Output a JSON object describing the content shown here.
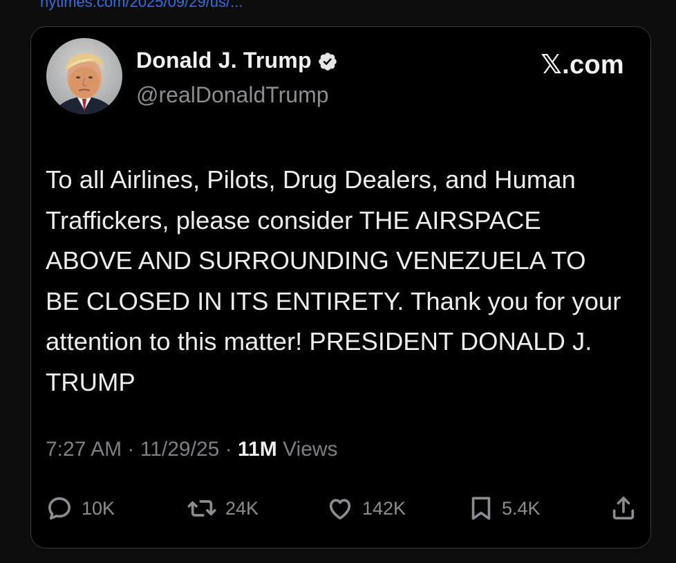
{
  "top_link": {
    "text": "nytimes.com/2025/09/29/us/..."
  },
  "post": {
    "author": {
      "display_name": "Donald J. Trump",
      "handle": "@realDonaldTrump",
      "verified_badge": "verified-checkmark-icon"
    },
    "brand": "𝕏.com",
    "text": "To all Airlines, Pilots, Drug Dealers, and Human Traffickers, please consider THE AIRSPACE ABOVE AND SURROUNDING VENEZUELA TO BE CLOSED IN ITS ENTIRETY. Thank you for your attention to this matter! PRESIDENT DONALD J. TRUMP",
    "time": "7:27 AM",
    "date": "11/29/25",
    "separator": "·",
    "views_count": "11M",
    "views_label": "Views",
    "actions": {
      "replies": "10K",
      "reposts": "24K",
      "likes": "142K",
      "bookmarks": "5.4K"
    }
  },
  "colors": {
    "background": "#000000",
    "page_background": "#0d0d0e",
    "card_border": "#3a3a3c",
    "primary_text": "#ededed",
    "secondary_text": "#8a8d91",
    "link": "#2f6fe4"
  }
}
